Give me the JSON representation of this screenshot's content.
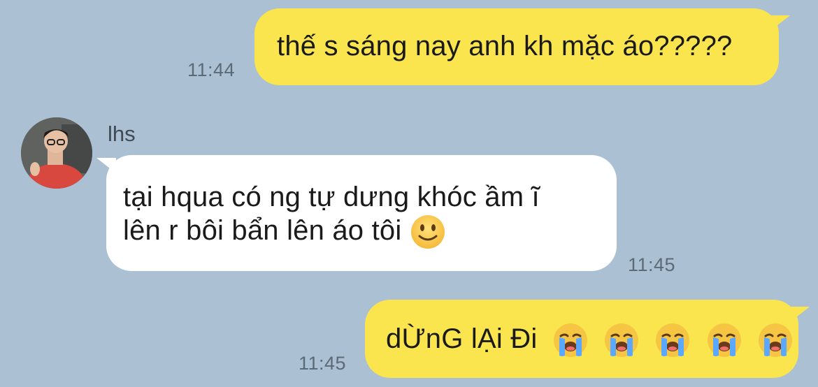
{
  "messages": [
    {
      "side": "mine",
      "text": "thế s sáng nay anh kh mặc áo?????",
      "time": "11:44"
    },
    {
      "side": "theirs",
      "sender": "lhs",
      "lines": [
        "tại hqua có ng tự dưng khóc ầm ĩ",
        "lên r bôi bẩn lên áo tôi"
      ],
      "emoji": "slightly-smiling-face",
      "time": "11:45"
    },
    {
      "side": "mine",
      "text": "dỪnG lẠi Đi",
      "emoji": "loudly-crying-face",
      "emoji_count": 5,
      "time": "11:45"
    }
  ],
  "colors": {
    "background": "#abc0d3",
    "mine_bubble": "#fbe54e",
    "theirs_bubble": "#ffffff",
    "timestamp": "#5c6a78"
  }
}
